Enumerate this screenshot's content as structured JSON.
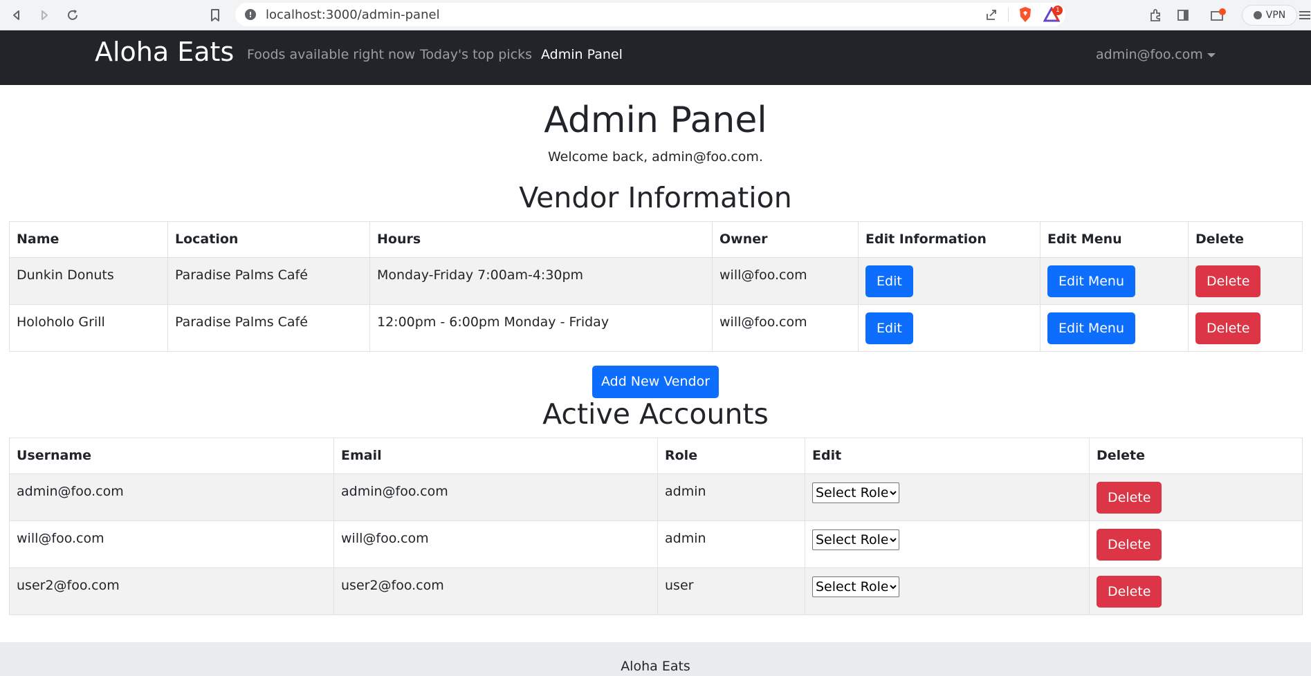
{
  "browser": {
    "url": "localhost:3000/admin-panel",
    "vpn_label": "VPN",
    "notification_count": "1"
  },
  "navbar": {
    "brand": "Aloha Eats",
    "links": [
      {
        "label": "Foods available right now",
        "active": false
      },
      {
        "label": "Today's top picks",
        "active": false
      },
      {
        "label": "Admin Panel",
        "active": true
      }
    ],
    "user": "admin@foo.com"
  },
  "page": {
    "title": "Admin Panel",
    "welcome": "Welcome back, admin@foo.com."
  },
  "vendors": {
    "heading": "Vendor Information",
    "columns": [
      "Name",
      "Location",
      "Hours",
      "Owner",
      "Edit Information",
      "Edit Menu",
      "Delete"
    ],
    "rows": [
      {
        "name": "Dunkin Donuts",
        "location": "Paradise Palms Café",
        "hours": "Monday-Friday 7:00am-4:30pm",
        "owner": "will@foo.com",
        "edit_label": "Edit",
        "edit_menu_label": "Edit Menu",
        "delete_label": "Delete"
      },
      {
        "name": "Holoholo Grill",
        "location": "Paradise Palms Café",
        "hours": "12:00pm - 6:00pm Monday - Friday",
        "owner": "will@foo.com",
        "edit_label": "Edit",
        "edit_menu_label": "Edit Menu",
        "delete_label": "Delete"
      }
    ],
    "add_label": "Add New Vendor"
  },
  "accounts": {
    "heading": "Active Accounts",
    "columns": [
      "Username",
      "Email",
      "Role",
      "Edit",
      "Delete"
    ],
    "rows": [
      {
        "username": "admin@foo.com",
        "email": "admin@foo.com",
        "role": "admin",
        "select_label": "Select Role",
        "delete_label": "Delete"
      },
      {
        "username": "will@foo.com",
        "email": "will@foo.com",
        "role": "admin",
        "select_label": "Select Role",
        "delete_label": "Delete"
      },
      {
        "username": "user2@foo.com",
        "email": "user2@foo.com",
        "role": "user",
        "select_label": "Select Role",
        "delete_label": "Delete"
      }
    ]
  },
  "footer": {
    "text": "Aloha Eats"
  },
  "colors": {
    "navbar": "#212529",
    "primary": "#0d6efd",
    "danger": "#dc3545",
    "striped_row": "#f2f2f2",
    "footer": "#e9ecef"
  }
}
